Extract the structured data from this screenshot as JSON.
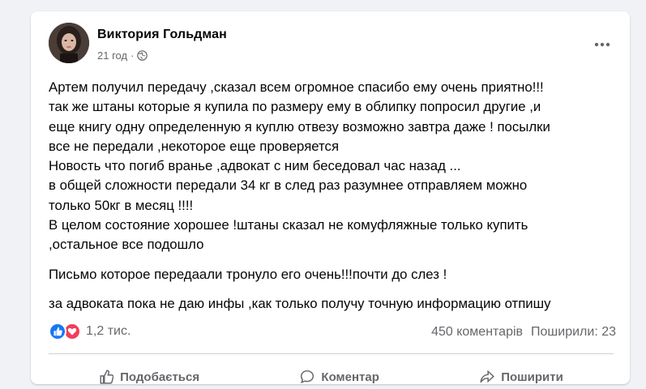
{
  "post": {
    "author": "Виктория Гольдман",
    "time": "21 год",
    "separator": "·",
    "body": [
      "Артем получил передачу ,сказал всем огромное спасибо ему очень приятно!!!",
      "так же штаны которые я купила по размеру ему в облипку попросил другие ,и",
      "еще книгу одну определенную я куплю отвезу возможно завтра даже ! посылки",
      "все не передали ,некоторое еще проверяется",
      "Новость что погиб вранье ,адвокат с ним беседовал час назад ...",
      "в общей сложности передали 34 кг в след раз разумнее отправляем можно",
      "только 50кг в месяц !!!!",
      "В целом состояние хорошее !штаны сказал не комуфляжные только купить",
      ",остальное все подошло"
    ],
    "paragraph2": "Письмо которое передаали тронуло его очень!!!почти до слез !",
    "paragraph3": "за адвоката пока не даю инфы ,как только получу точную информацию отпишу"
  },
  "stats": {
    "reactions_count": "1,2 тис.",
    "comments": "450 коментарів",
    "shares": "Поширили: 23"
  },
  "actions": {
    "like": "Подобається",
    "comment": "Коментар",
    "share": "Поширити"
  },
  "icons": {
    "more": "more-options-icon",
    "privacy": "globe-icon",
    "reaction1": "like-icon",
    "reaction2": "love-icon"
  },
  "colors": {
    "like": "#1877f2",
    "love": "#f33e58",
    "secondary_text": "#65676b"
  }
}
